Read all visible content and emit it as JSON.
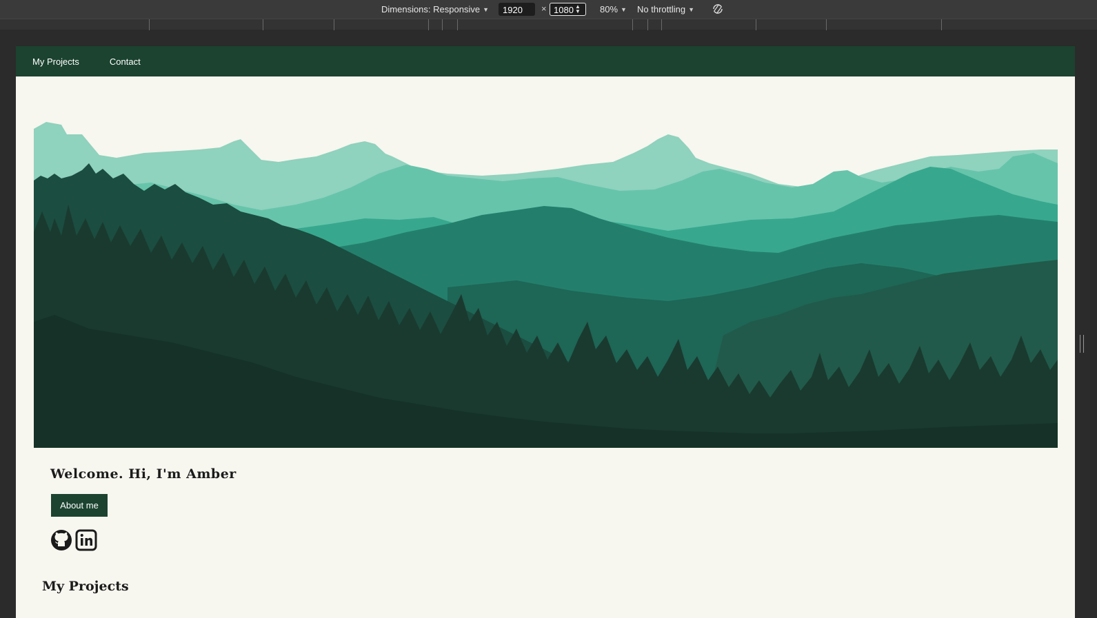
{
  "devtools": {
    "dimensions_label": "Dimensions: Responsive",
    "width_value": "1920",
    "height_value": "1080",
    "times": "×",
    "zoom": "80%",
    "throttling": "No throttling"
  },
  "nav": {
    "items": [
      {
        "label": "My Projects"
      },
      {
        "label": "Contact"
      }
    ]
  },
  "hero": {
    "welcome": "Welcome. Hi, I'm Amber",
    "about_button": "About me"
  },
  "social": {
    "github_icon": "github-icon",
    "linkedin_icon": "linkedin-icon",
    "linkedin_text": "in"
  },
  "sections": {
    "projects_heading": "My Projects"
  },
  "colors": {
    "nav_bg": "#1b4330",
    "page_bg": "#f7f6ef",
    "forest_dark": "#1a3a2f",
    "mountain_light": "#8fd2bd"
  }
}
